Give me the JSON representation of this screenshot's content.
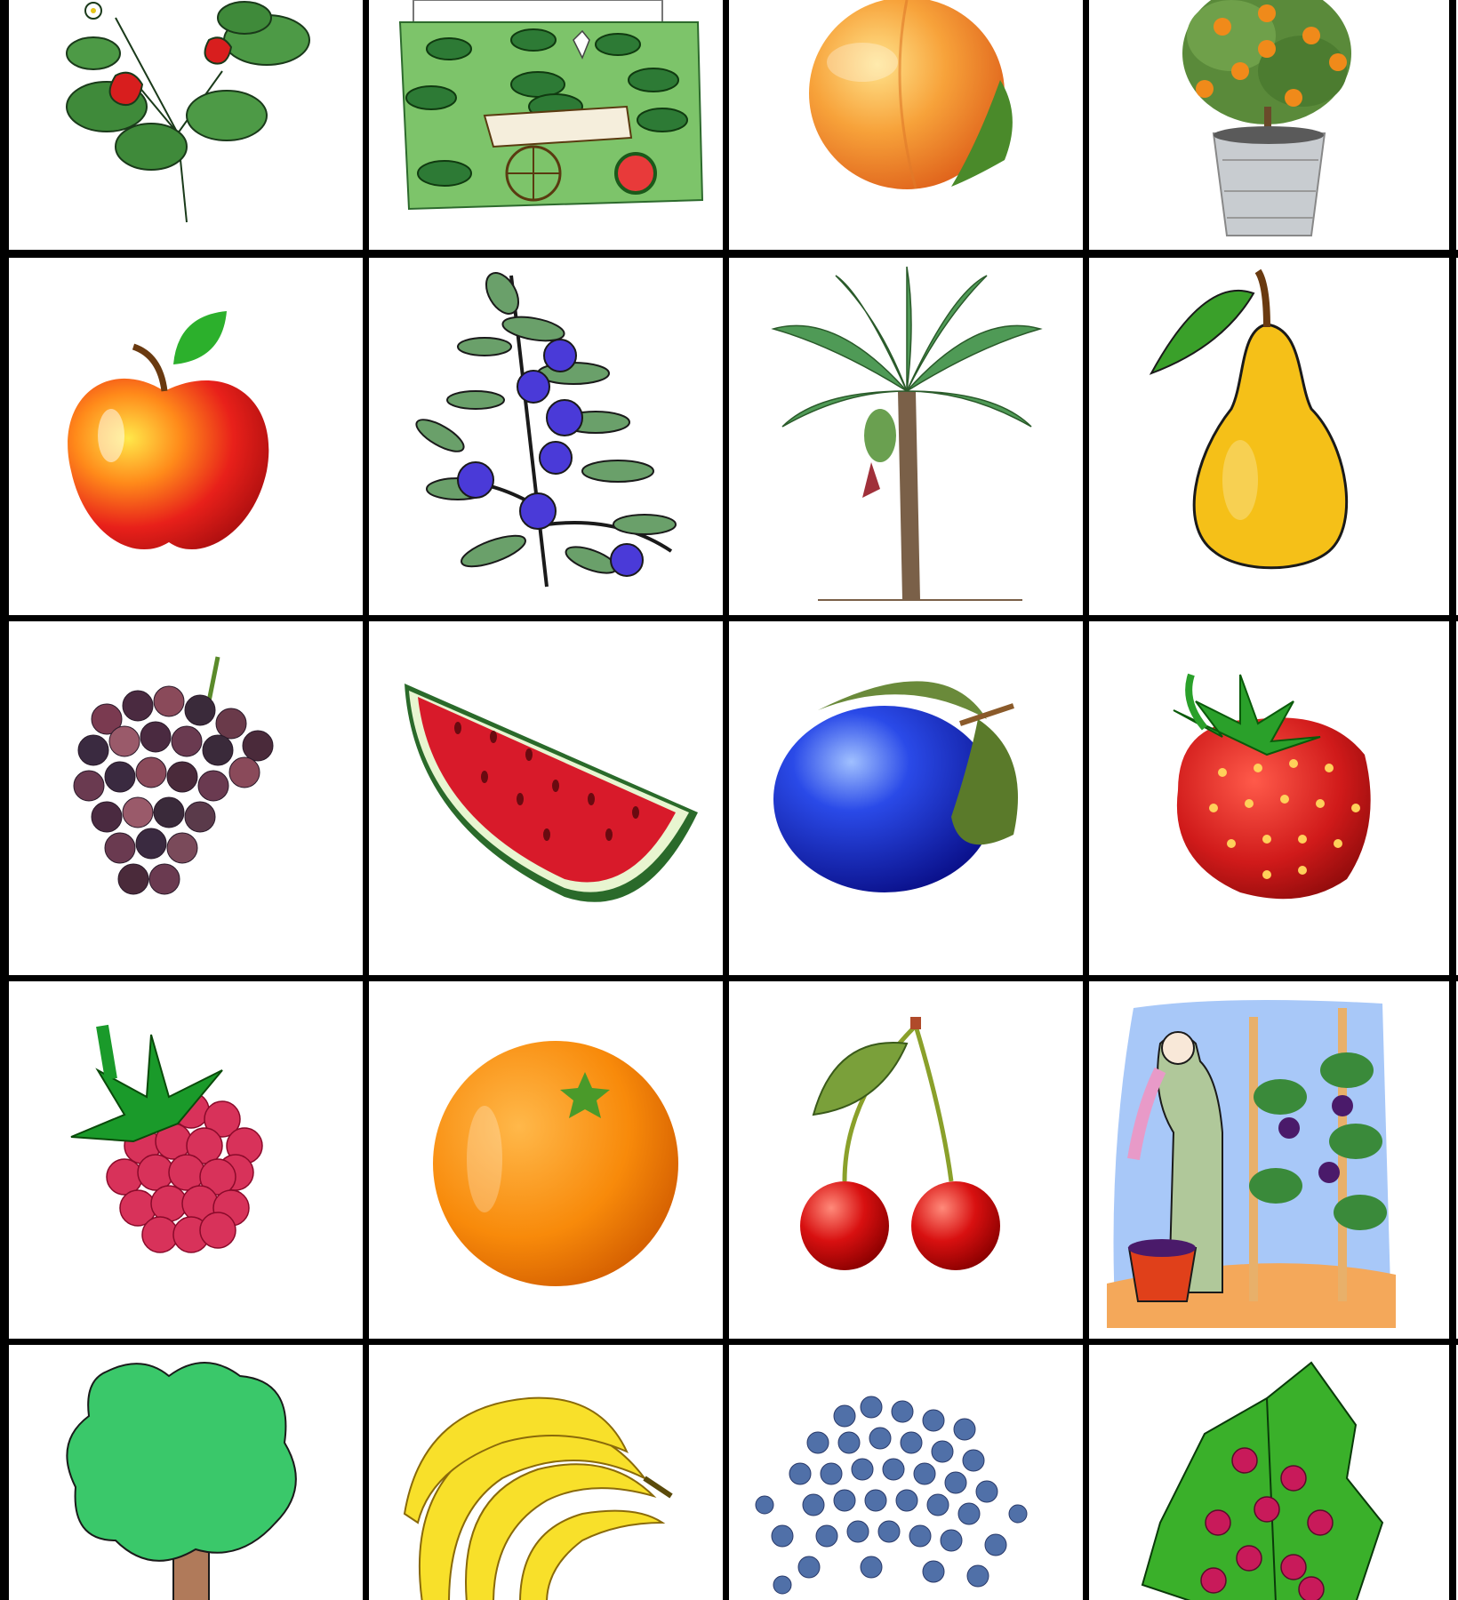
{
  "grid": {
    "columns": 4,
    "rows": 5,
    "cards": [
      {
        "picture": "strawberry-plant-icon"
      },
      {
        "picture": "watermelon-field-icon"
      },
      {
        "picture": "peach-icon"
      },
      {
        "picture": "potted-orange-tree-icon"
      },
      {
        "picture": "apple-icon"
      },
      {
        "picture": "blueberry-branch-icon"
      },
      {
        "picture": "banana-tree-icon"
      },
      {
        "picture": "pear-icon"
      },
      {
        "picture": "grapes-icon"
      },
      {
        "picture": "watermelon-slice-icon"
      },
      {
        "picture": "plum-icon"
      },
      {
        "picture": "strawberry-icon"
      },
      {
        "picture": "raspberry-icon"
      },
      {
        "picture": "orange-icon"
      },
      {
        "picture": "cherries-icon"
      },
      {
        "picture": "grape-harvest-icon"
      },
      {
        "picture": "green-tree-icon"
      },
      {
        "picture": "banana-bunch-icon"
      },
      {
        "picture": "blueberries-pile-icon"
      },
      {
        "picture": "raspberry-bush-icon"
      }
    ]
  },
  "colors": {
    "border": "#000000",
    "background": "#ffffff"
  }
}
